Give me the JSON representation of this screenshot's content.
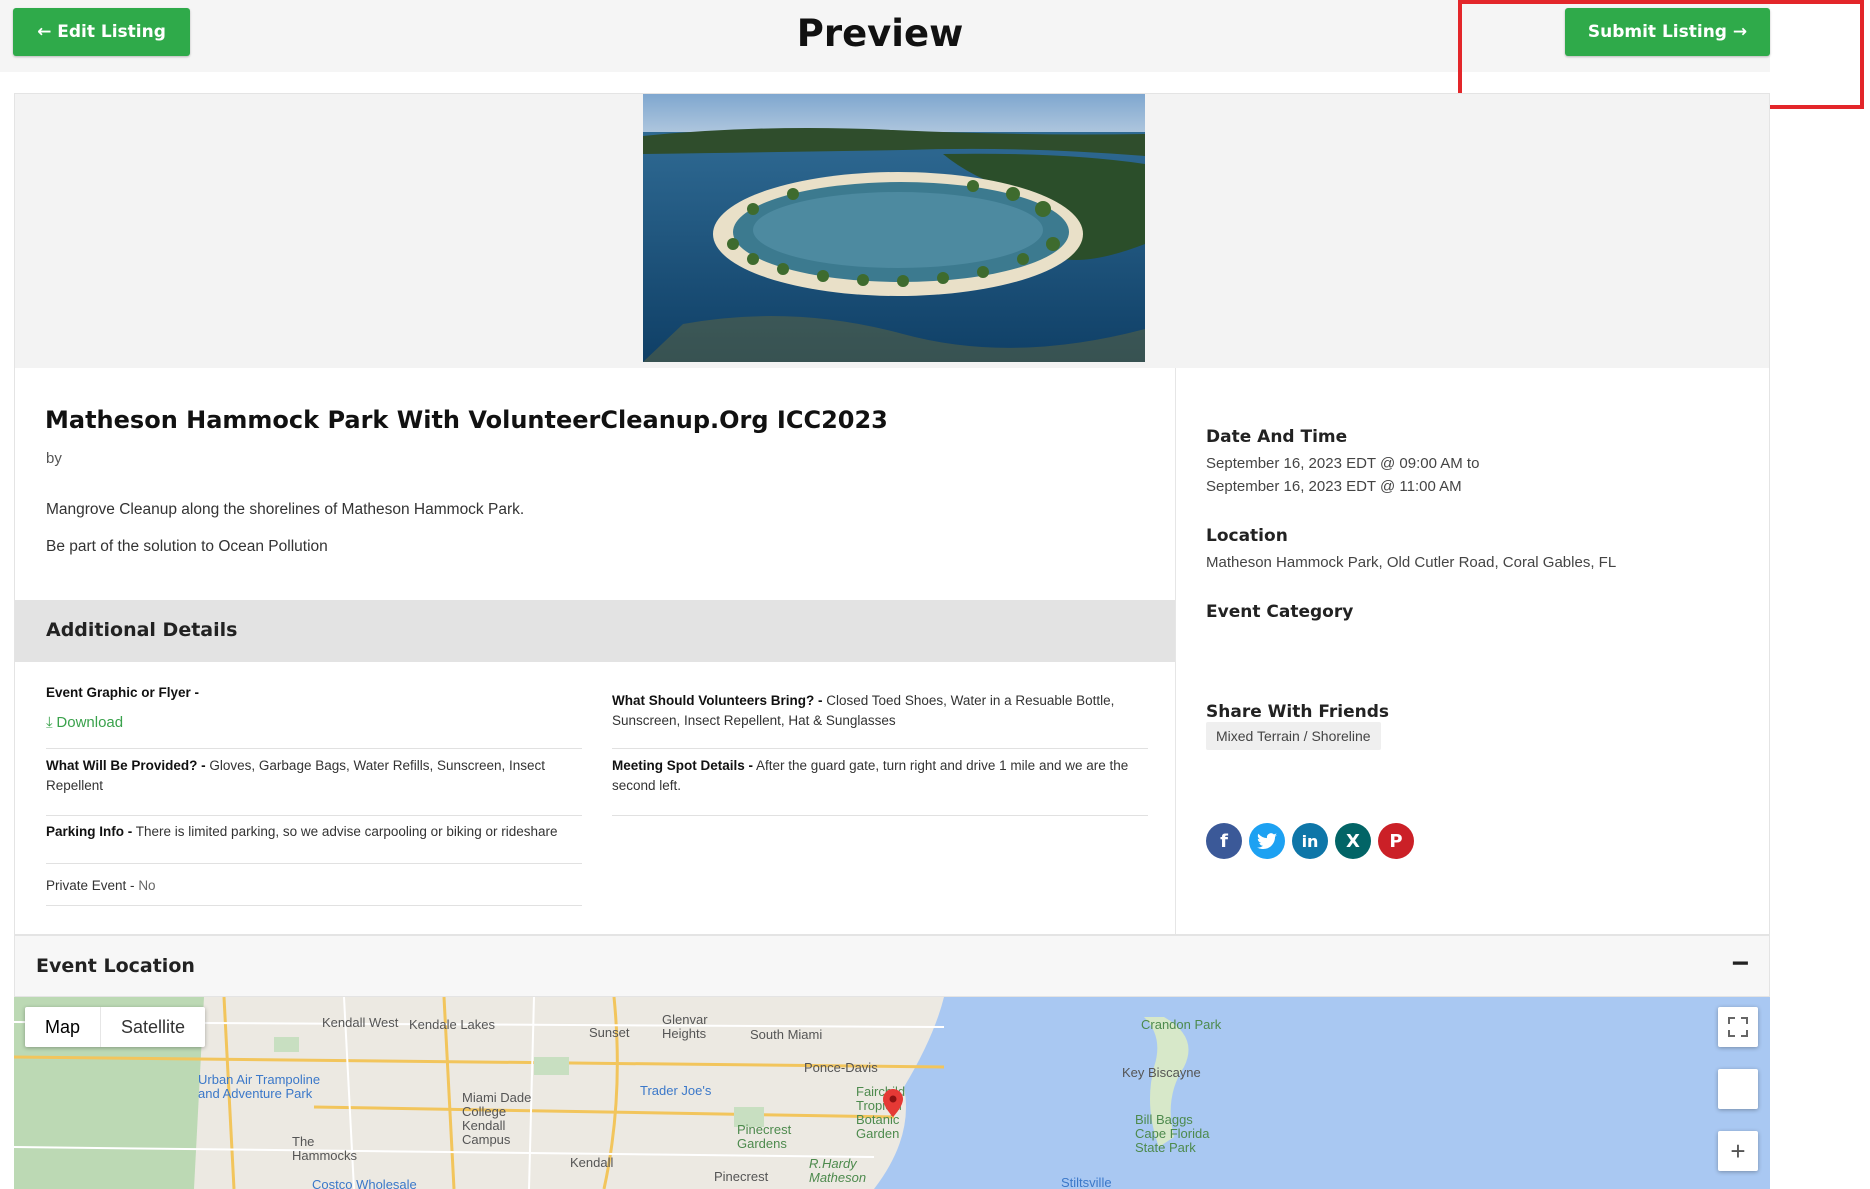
{
  "header": {
    "edit_label": "← Edit Listing",
    "title": "Preview",
    "submit_label": "Submit Listing →"
  },
  "event": {
    "title": "Matheson Hammock Park With VolunteerCleanup.Org ICC2023",
    "by": "by",
    "description": [
      "Mangrove Cleanup along the shorelines of Matheson Hammock Park.",
      "Be part of the solution to Ocean Pollution"
    ]
  },
  "additional": {
    "heading": "Additional Details",
    "graphic_label": "Event Graphic or Flyer -",
    "download_label": "Download",
    "provided_label": "What Will Be Provided? -",
    "provided_value": "Gloves, Garbage Bags, Water Refills, Sunscreen, Insect Repellent",
    "parking_label": "Parking Info -",
    "parking_value": "There is limited parking, so we advise carpooling or biking or rideshare",
    "private_label": "Private Event -",
    "private_value": "No",
    "bring_label": "What Should Volunteers Bring? -",
    "bring_value": "Closed Toed Shoes, Water in a Resuable Bottle, Sunscreen, Insect Repellent, Hat & Sunglasses",
    "meeting_label": "Meeting Spot Details -",
    "meeting_value": "After the guard gate, turn right and drive 1 mile and we are the second left."
  },
  "sidebar": {
    "date_heading": "Date And Time",
    "date_start": "September 16, 2023 EDT @  09:00 AM to",
    "date_end": "September 16, 2023 EDT @  11:00 AM",
    "location_heading": "Location",
    "location_value": "Matheson Hammock Park, Old Cutler Road, Coral Gables, FL",
    "category_heading": "Event Category",
    "category_value": "Mixed Terrain / Shoreline",
    "share_heading": "Share With Friends"
  },
  "location_section": {
    "heading": "Event Location",
    "collapse_label": "−",
    "map_label": "Map",
    "satellite_label": "Satellite",
    "zoom_in_label": "+",
    "places": [
      "Kendall West",
      "Kendale Lakes",
      "Sunset",
      "Glenvar Heights",
      "South Miami",
      "Crandon Park",
      "Ponce-Davis",
      "Key Biscayne",
      "Urban Air Trampoline and Adventure Park",
      "Trader Joe's",
      "Miami Dade College Kendall Campus",
      "Fairchild Tropical Botanic Garden",
      "Bill Baggs Cape Florida State Park",
      "Pinecrest Gardens",
      "The Hammocks",
      "Kendall",
      "Pinecrest",
      "R.Hardy Matheson",
      "Stiltsville",
      "Costco Wholesale"
    ]
  },
  "colors": {
    "accent_green": "#2faa4a",
    "highlight_red": "#e3262a",
    "facebook": "#3b5998",
    "twitter": "#1da1f2",
    "linkedin": "#0e76a8",
    "xing": "#026466",
    "pinterest": "#cb2027"
  },
  "icons": [
    "download-icon",
    "facebook-icon",
    "twitter-icon",
    "linkedin-icon",
    "xing-icon",
    "pinterest-icon",
    "fullscreen-icon",
    "map-pin-icon"
  ]
}
